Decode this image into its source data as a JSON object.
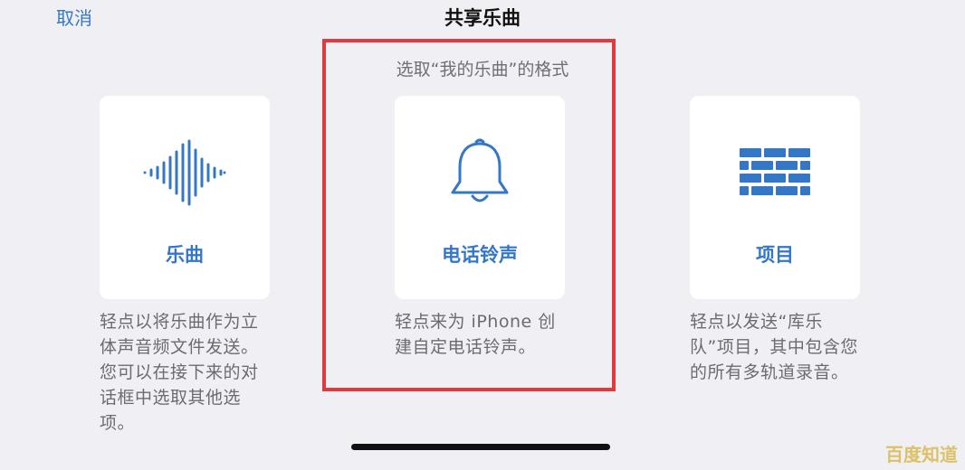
{
  "header": {
    "cancel_label": "取消",
    "title": "共享乐曲"
  },
  "subtitle": "选取“我的乐曲”的格式",
  "options": [
    {
      "label": "乐曲",
      "icon": "waveform-icon",
      "description": "轻点以将乐曲作为立体声音频文件发送。您可以在接下来的对话框中选取其他选项。"
    },
    {
      "label": "电话铃声",
      "icon": "bell-icon",
      "description": "轻点来为 iPhone 创建自定电话铃声。"
    },
    {
      "label": "项目",
      "icon": "bricks-icon",
      "description": "轻点以发送“库乐队”项目，其中包含您的所有多轨道录音。"
    }
  ],
  "watermark": "百度知道",
  "colors": {
    "accent": "#3477c7",
    "highlight_border": "#e03a3e",
    "background": "#f0f0f4"
  }
}
